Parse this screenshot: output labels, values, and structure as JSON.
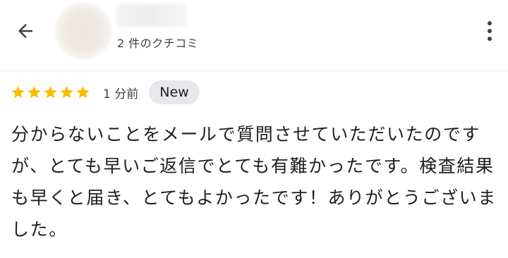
{
  "header": {
    "back_icon": "arrow-left-icon",
    "review_count_label": "2 件のクチコミ",
    "menu_icon": "more-vert-icon"
  },
  "review": {
    "rating": 5,
    "star_color": "#fbbc04",
    "time": "1 分前",
    "badge": "New",
    "text": "分からないことをメールで質問させていただいたのですが、とても早いご返信でとても有難かったです。検査結果も早くと届き、とてもよかったです！ありがとうございました。"
  }
}
